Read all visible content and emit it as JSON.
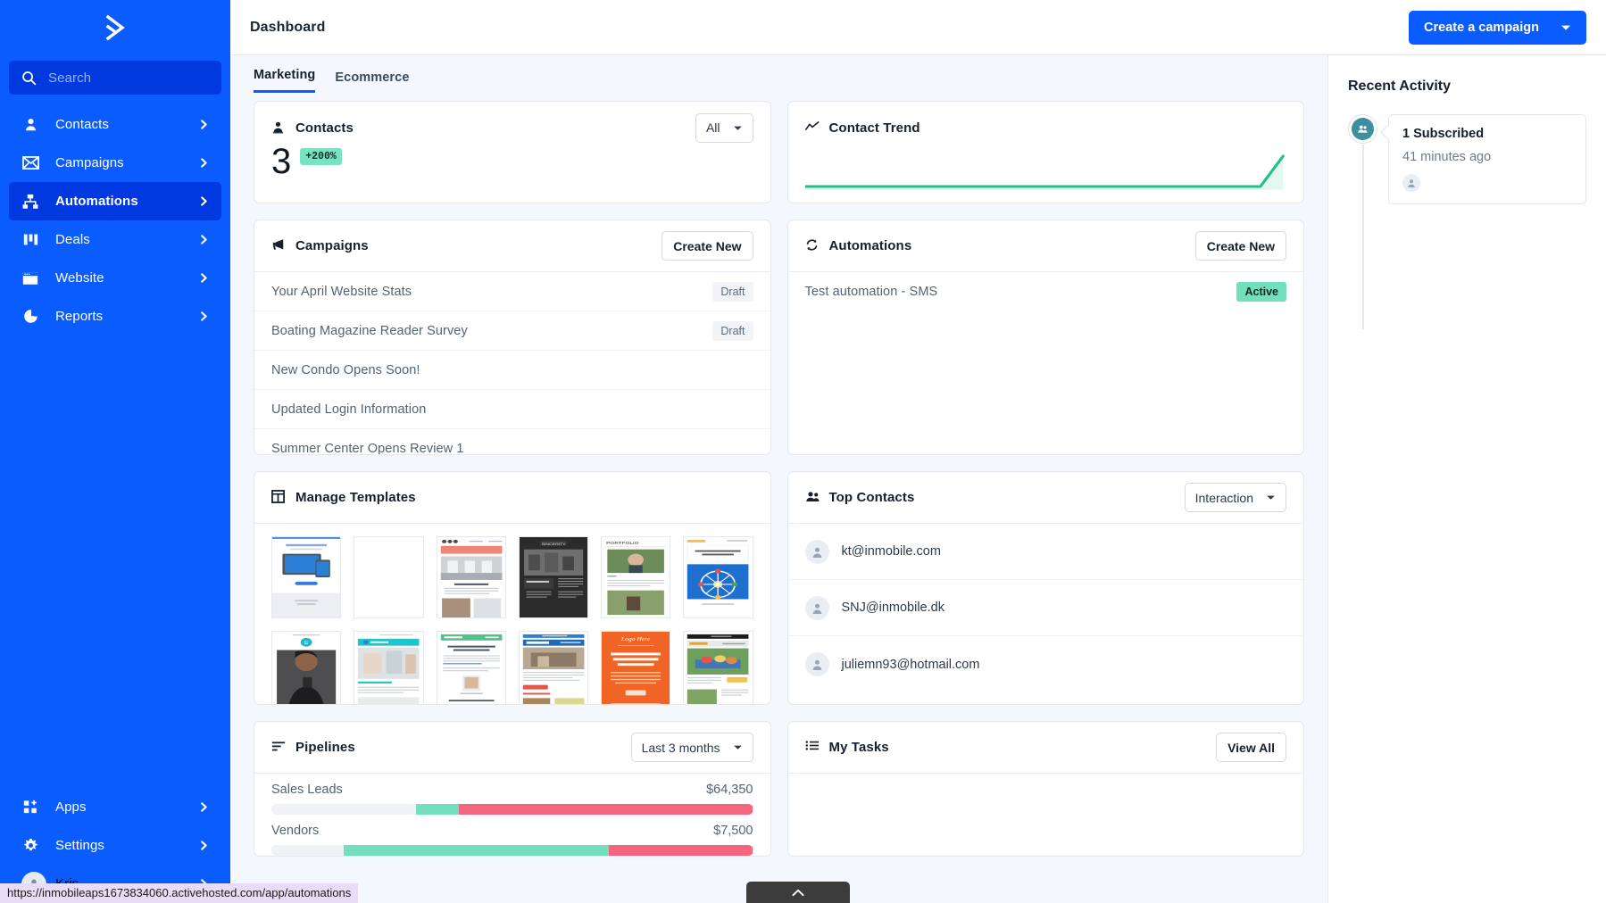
{
  "sidebar": {
    "logo_name": "activecampaign-logo",
    "search": {
      "placeholder": "Search"
    },
    "items": [
      {
        "label": "Contacts",
        "icon": "person-icon",
        "active": false
      },
      {
        "label": "Campaigns",
        "icon": "envelope-icon",
        "active": false
      },
      {
        "label": "Automations",
        "icon": "sitemap-icon",
        "active": true
      },
      {
        "label": "Deals",
        "icon": "columns-icon",
        "active": false
      },
      {
        "label": "Website",
        "icon": "browser-icon",
        "active": false
      },
      {
        "label": "Reports",
        "icon": "pie-chart-icon",
        "active": false
      }
    ],
    "bottom_items": [
      {
        "label": "Apps",
        "icon": "apps-grid-plus-icon"
      },
      {
        "label": "Settings",
        "icon": "gear-icon"
      },
      {
        "label": "Kris",
        "icon": "user-avatar-icon"
      }
    ]
  },
  "header": {
    "title": "Dashboard",
    "cta_label": "Create a campaign"
  },
  "tabs": [
    {
      "label": "Marketing",
      "selected": true
    },
    {
      "label": "Ecommerce",
      "selected": false
    }
  ],
  "contacts_card": {
    "title": "Contacts",
    "icon": "person-icon",
    "filter_value": "All",
    "count": "3",
    "delta": "+200%"
  },
  "trend_card": {
    "title": "Contact Trend",
    "icon": "trend-line-icon",
    "line_color": "#23bf89"
  },
  "campaigns_card": {
    "title": "Campaigns",
    "icon": "megaphone-icon",
    "button_label": "Create New",
    "rows": [
      {
        "name": "Your April Website Stats",
        "status": "Draft"
      },
      {
        "name": "Boating Magazine Reader Survey",
        "status": "Draft"
      },
      {
        "name": "New Condo Opens Soon!",
        "status": ""
      },
      {
        "name": "Updated Login Information",
        "status": ""
      },
      {
        "name": "Summer Center Opens Review 1",
        "status": ""
      }
    ]
  },
  "automations_card": {
    "title": "Automations",
    "icon": "sync-icon",
    "button_label": "Create New",
    "rows": [
      {
        "name": "Test automation - SMS",
        "status": "Active"
      }
    ]
  },
  "templates_card": {
    "title": "Manage Templates",
    "icon": "template-icon",
    "thumbnails": [
      "tablet-promo-template",
      "blank-template",
      "modernist-template",
      "sincerity-dark-template",
      "portfolio-template",
      "playbook-ferris-template",
      "person-phone-template",
      "office-space-template",
      "better-marketing-template",
      "home-decor-template",
      "orange-lorem-template",
      "rafting-news-template"
    ]
  },
  "top_contacts_card": {
    "title": "Top Contacts",
    "icon": "people-icon",
    "filter_value": "Interaction",
    "rows": [
      {
        "email": "kt@inmobile.com"
      },
      {
        "email": "SNJ@inmobile.dk"
      },
      {
        "email": "juliemn93@hotmail.com"
      }
    ]
  },
  "pipelines_card": {
    "title": "Pipelines",
    "icon": "sort-lines-icon",
    "filter_value": "Last 3 months",
    "rows": [
      {
        "name": "Sales Leads",
        "amount": "$64,350",
        "segments": [
          {
            "color": "#f0f2f6",
            "pct": 30
          },
          {
            "color": "#72e0bd",
            "pct": 9
          },
          {
            "color": "#f4657f",
            "pct": 61
          }
        ]
      },
      {
        "name": "Vendors",
        "amount": "$7,500",
        "segments": [
          {
            "color": "#f0f2f6",
            "pct": 15
          },
          {
            "color": "#72e0bd",
            "pct": 55
          },
          {
            "color": "#f4657f",
            "pct": 30
          }
        ]
      }
    ]
  },
  "tasks_card": {
    "title": "My Tasks",
    "icon": "list-icon",
    "button_label": "View All"
  },
  "recent_activity": {
    "title": "Recent Activity",
    "items": [
      {
        "icon": "subscribers-icon",
        "headline": "1 Subscribed",
        "time": "41 minutes ago",
        "avatar": "contact-avatar-icon"
      }
    ]
  },
  "status_bar": {
    "url": "https://inmobileaps1673834060.activehosted.com/app/automations"
  },
  "scroll_top": {
    "icon": "chevron-up-icon"
  },
  "colors": {
    "brand_blue": "#0b5cff",
    "sidebar_active": "#0039e0",
    "green": "#72e0bd",
    "red": "#f4657f",
    "bg": "#f4f7fd"
  }
}
